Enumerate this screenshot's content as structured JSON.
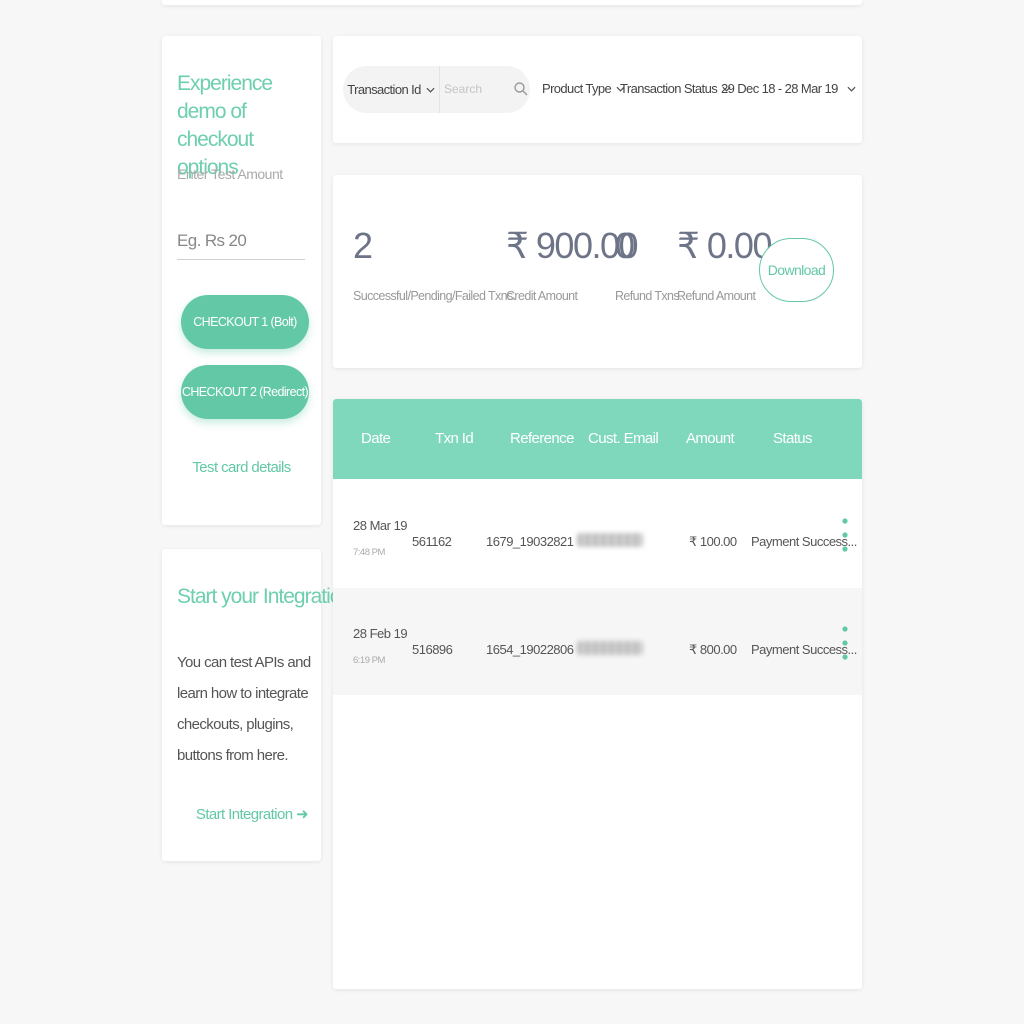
{
  "checkout_card": {
    "title": "Experience demo of checkout options",
    "amount_label": "Enter Test Amount",
    "amount_placeholder": "Eg. Rs 20",
    "checkout1_label": "CHECKOUT 1 (Bolt)",
    "checkout2_label": "CHECKOUT 2 (Redirect)",
    "test_card_link": "Test card details"
  },
  "integration_card": {
    "title": "Start your Integration",
    "description": "You can test APIs and learn how to integrate checkouts, plugins, buttons from here.",
    "link_label": "Start Integration ➜"
  },
  "filters": {
    "txn_id_label": "Transaction Id",
    "search_placeholder": "Search",
    "product_type": "Product Type",
    "transaction_status": "Transaction Status",
    "date_range": "29 Dec 18 - 28 Mar 19"
  },
  "stats": {
    "txns_value": "2",
    "txns_label": "Successful/Pending/Failed Txns.",
    "credit_value": "₹ 900.00",
    "credit_label": "Credit Amount",
    "refund_txns_value": "0",
    "refund_txns_label": "Refund Txns.",
    "refund_amount_value": "₹ 0.00",
    "refund_amount_label": "Refund Amount",
    "download_label": "Download"
  },
  "table": {
    "headers": {
      "date": "Date",
      "txn_id": "Txn Id",
      "reference": "Reference",
      "email": "Cust. Email",
      "amount": "Amount",
      "status": "Status"
    },
    "rows": [
      {
        "date": "28 Mar 19",
        "time": "7:48 PM",
        "txn_id": "561162",
        "reference": "1679_19032821",
        "amount": "₹ 100.00",
        "status": "Payment Success..."
      },
      {
        "date": "28 Feb 19",
        "time": "6:19 PM",
        "txn_id": "516896",
        "reference": "1654_19022806",
        "amount": "₹ 800.00",
        "status": "Payment Success..."
      }
    ]
  },
  "colors": {
    "accent": "#63c8a6",
    "table_header": "#7fd8bb",
    "stat_text": "#6e7488"
  },
  "icons": {
    "search": "search-icon",
    "chevron": "chevron-down-icon",
    "kebab": "more-vertical-icon",
    "arrow": "arrow-right-icon"
  }
}
